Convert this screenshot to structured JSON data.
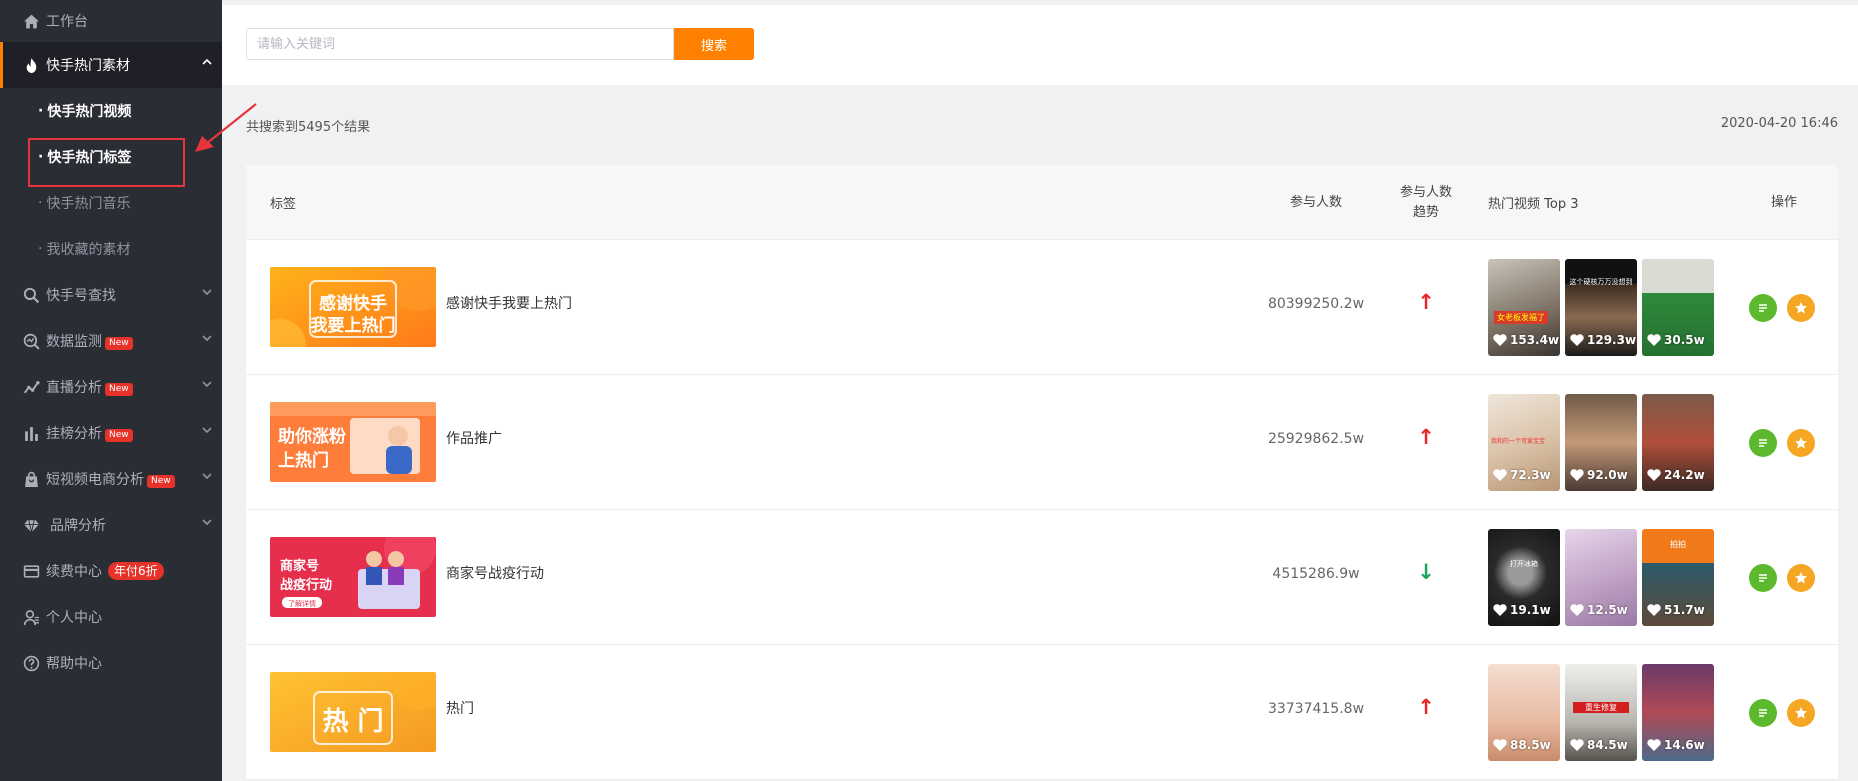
{
  "sidebar": {
    "items": [
      {
        "label": "工作台",
        "icon": "home-icon"
      },
      {
        "label": "快手热门素材",
        "icon": "fire-icon"
      },
      {
        "label": "快手号查找",
        "icon": "search-icon"
      },
      {
        "label": "数据监测",
        "icon": "monitor-icon",
        "badge": "New"
      },
      {
        "label": "直播分析",
        "icon": "line-chart-icon",
        "badge": "New"
      },
      {
        "label": "挂榜分析",
        "icon": "bar-chart-icon",
        "badge": "New"
      },
      {
        "label": "短视频电商分析",
        "icon": "shopping-bag-icon",
        "badge": "New"
      },
      {
        "label": "品牌分析",
        "icon": "diamond-icon"
      },
      {
        "label": "续费中心",
        "icon": "card-icon",
        "badge": "年付6折"
      },
      {
        "label": "个人中心",
        "icon": "user-icon"
      },
      {
        "label": "帮助中心",
        "icon": "help-icon"
      }
    ],
    "subitems": [
      {
        "label": "快手热门视频"
      },
      {
        "label": "快手热门标签"
      },
      {
        "label": "快手热门音乐"
      },
      {
        "label": "我收藏的素材"
      }
    ]
  },
  "search": {
    "placeholder": "请输入关键词",
    "button_label": "搜索"
  },
  "results": {
    "count_text": "共搜索到5495个结果",
    "date": "2020-04-20 16:46"
  },
  "table": {
    "headers": {
      "tag": "标签",
      "participants": "参与人数",
      "trend_line1": "参与人数",
      "trend_line2": "趋势",
      "top_videos": "热门视频 Top 3",
      "actions": "操作"
    },
    "rows": [
      {
        "thumb_text_1": "感谢快手",
        "thumb_text_2": "我要上热门",
        "name": "感谢快手我要上热门",
        "count": "80399250.2w",
        "trend": "up",
        "trend_symbol": "↑",
        "videos": [
          {
            "likes": "153.4w",
            "caption": "女老板发福了"
          },
          {
            "likes": "129.3w",
            "caption": "这个硬核万万没想到"
          },
          {
            "likes": "30.5w",
            "caption": ""
          }
        ]
      },
      {
        "thumb_text_1": "助你涨粉",
        "thumb_text_2": "上热门",
        "name": "作品推广",
        "count": "25929862.5w",
        "trend": "up",
        "trend_symbol": "↑",
        "videos": [
          {
            "likes": "72.3w",
            "caption": "我和的一个可爱宝宝"
          },
          {
            "likes": "92.0w",
            "caption": ""
          },
          {
            "likes": "24.2w",
            "caption": ""
          }
        ]
      },
      {
        "thumb_text_1": "商家号",
        "thumb_text_2": "战疫行动",
        "thumb_text_3": "了解详情",
        "name": "商家号战疫行动",
        "count": "4515286.9w",
        "trend": "down",
        "trend_symbol": "↓",
        "videos": [
          {
            "likes": "19.1w",
            "caption": "打开冰箱"
          },
          {
            "likes": "12.5w",
            "caption": ""
          },
          {
            "likes": "51.7w",
            "caption": "拍拍"
          }
        ]
      },
      {
        "thumb_text_1": "热 门",
        "name": "热门",
        "count": "33737415.8w",
        "trend": "up",
        "trend_symbol": "↑",
        "videos": [
          {
            "likes": "88.5w",
            "caption": ""
          },
          {
            "likes": "84.5w",
            "caption": "重生修复"
          },
          {
            "likes": "14.6w",
            "caption": ""
          }
        ]
      }
    ]
  },
  "colors": {
    "accent": "#ff8000",
    "sidebar_bg": "#2b2d35",
    "trend_up": "#e8262b",
    "trend_down": "#16a95c",
    "op_detail": "#5cb82c",
    "op_fav": "#f5a623",
    "highlight": "#e8353b"
  }
}
